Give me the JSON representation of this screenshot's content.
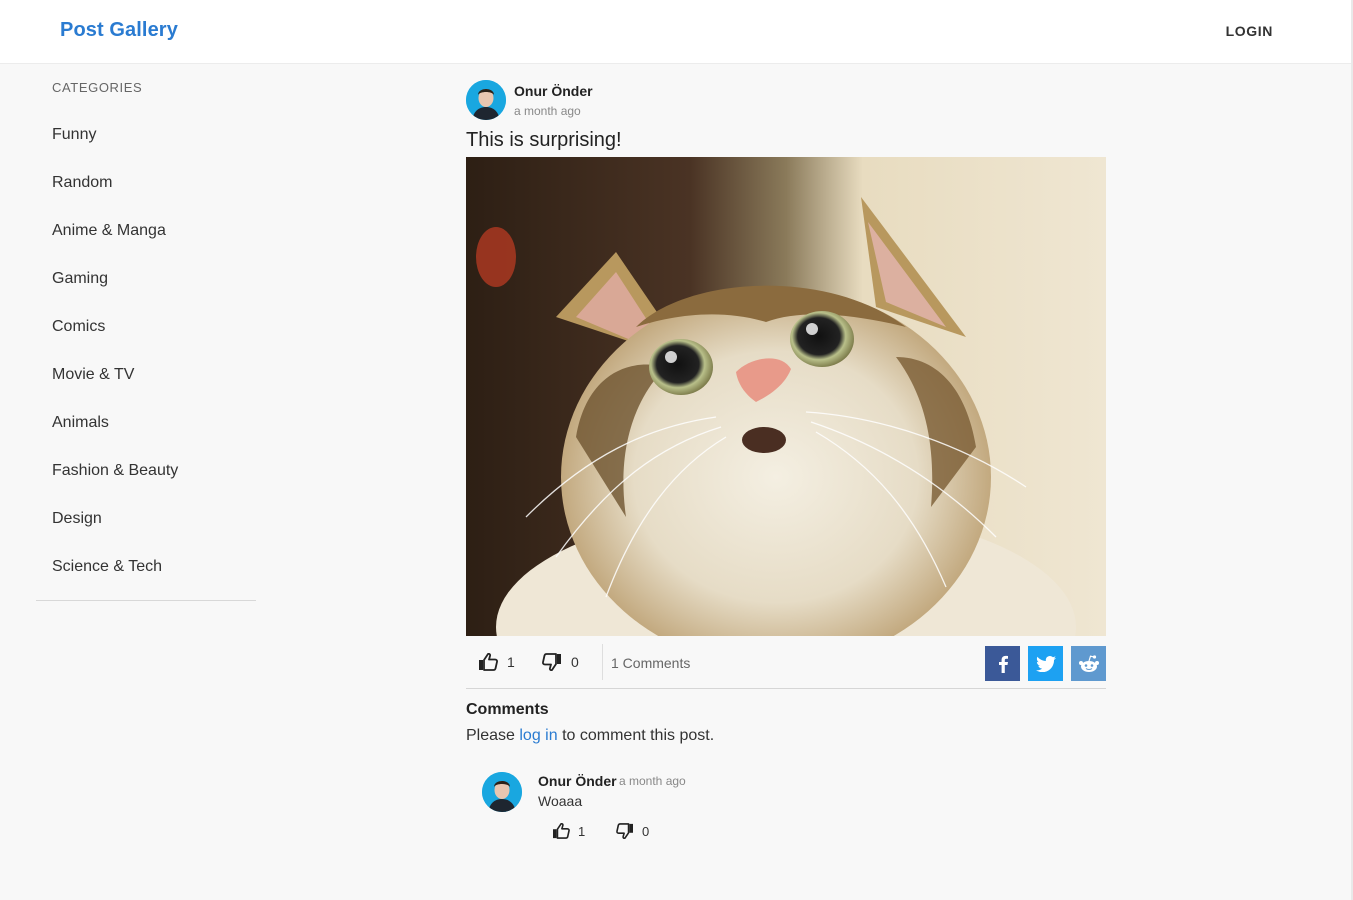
{
  "header": {
    "brand": "Post Gallery",
    "login_label": "LOGIN"
  },
  "sidebar": {
    "title": "CATEGORIES",
    "items": [
      {
        "label": "Funny"
      },
      {
        "label": "Random"
      },
      {
        "label": "Anime & Manga"
      },
      {
        "label": "Gaming"
      },
      {
        "label": "Comics"
      },
      {
        "label": "Movie & TV"
      },
      {
        "label": "Animals"
      },
      {
        "label": "Fashion & Beauty"
      },
      {
        "label": "Design"
      },
      {
        "label": "Science & Tech"
      }
    ]
  },
  "post": {
    "author": "Onur Önder",
    "time": "a month ago",
    "title": "This is surprising!",
    "image_subject": "surprised cat photo",
    "likes": "1",
    "dislikes": "0",
    "comments_label": "1 Comments",
    "share": {
      "facebook_icon": "facebook-icon",
      "twitter_icon": "twitter-icon",
      "reddit_icon": "reddit-icon"
    }
  },
  "comments_section": {
    "heading": "Comments",
    "prompt_before": "Please ",
    "prompt_link": "log in",
    "prompt_after": " to comment this post.",
    "items": [
      {
        "author": "Onur Önder",
        "time": "a month ago",
        "text": "Woaaa",
        "likes": "1",
        "dislikes": "0"
      }
    ]
  },
  "colors": {
    "brand": "#2a7bd1",
    "facebook": "#3b5998",
    "twitter": "#1da1f2",
    "reddit": "#5f99cf",
    "avatar_bg": "#19a7e0"
  }
}
